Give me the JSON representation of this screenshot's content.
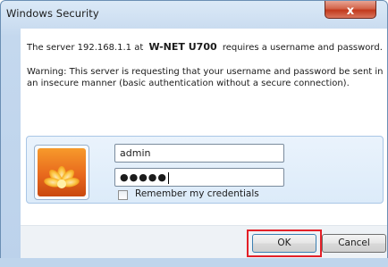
{
  "window": {
    "title": "Windows Security",
    "close_glyph": "x"
  },
  "message": {
    "prefix": "The server 192.168.1.1 at",
    "device": "W-NET U700",
    "suffix": "requires a username and password."
  },
  "warning": "Warning: This server is requesting that your username and password be sent in an insecure manner (basic authentication without a secure connection).",
  "credentials": {
    "username": "admin",
    "password_mask": "●●●●●",
    "remember_label": "Remember my credentials",
    "remember_checked": false,
    "tile_icon": "user-tile-flower-icon"
  },
  "buttons": {
    "ok": "OK",
    "cancel": "Cancel"
  },
  "colors": {
    "highlight": "#e32028",
    "close_button": "#c2391c"
  }
}
